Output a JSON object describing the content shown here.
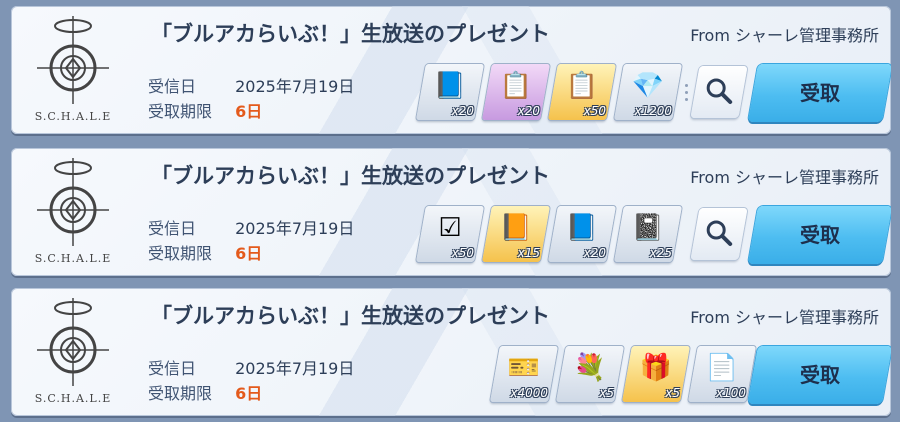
{
  "logo_text": "S.C.H.A.L.E",
  "labels": {
    "received": "受信日",
    "deadline": "受取期限",
    "receive_button": "受取"
  },
  "colors": {
    "accent_blue": "#4dbdf1",
    "deadline_red": "#e45a1c",
    "text_dark": "#2d3e58"
  },
  "mails": [
    {
      "title": "「ブルアカらいぶ！」生放送のプレゼント",
      "sender": "From シャーレ管理事務所",
      "received_date": "2025年7月19日",
      "deadline": "6日",
      "has_search": true,
      "items": [
        {
          "icon": "silver-report-icon",
          "qty": "x20"
        },
        {
          "icon": "purple-report-icon",
          "qty": "x20"
        },
        {
          "icon": "gold-report-icon",
          "qty": "x50"
        },
        {
          "icon": "pyroxene-icon",
          "qty": "x1200"
        }
      ]
    },
    {
      "title": "「ブルアカらいぶ！」生放送のプレゼント",
      "sender": "From シャーレ管理事務所",
      "received_date": "2025年7月19日",
      "deadline": "6日",
      "has_search": true,
      "items": [
        {
          "icon": "checkbox-ticket-icon",
          "qty": "x50"
        },
        {
          "icon": "gold-skill-book-icon",
          "qty": "x15"
        },
        {
          "icon": "blue-skill-book-icon",
          "qty": "x20"
        },
        {
          "icon": "silver-skill-book-icon",
          "qty": "x25"
        }
      ]
    },
    {
      "title": "「ブルアカらいぶ！」生放送のプレゼント",
      "sender": "From シャーレ管理事務所",
      "received_date": "2025年7月19日",
      "deadline": "6日",
      "has_search": false,
      "items": [
        {
          "icon": "ticket-icon",
          "qty": "x4000"
        },
        {
          "icon": "bouquet-icon",
          "qty": "x5"
        },
        {
          "icon": "gift-box-icon",
          "qty": "x5"
        },
        {
          "icon": "stamina-card-icon",
          "qty": "x100"
        }
      ]
    }
  ]
}
